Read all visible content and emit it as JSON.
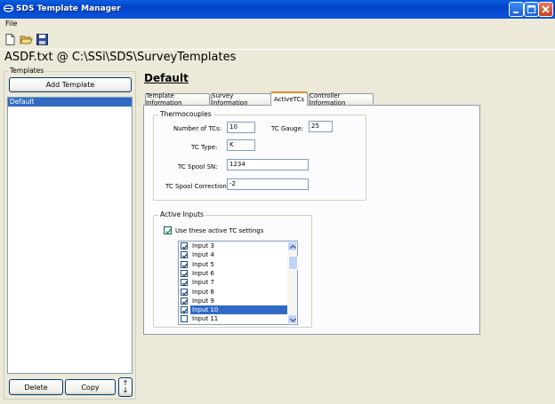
{
  "window": {
    "title": "SDS Template Manager"
  },
  "menu": {
    "file": "File"
  },
  "toolbar": {
    "icons": [
      "new-file-icon",
      "open-folder-icon",
      "save-icon"
    ]
  },
  "path_heading": "ASDF.txt @ C:\\SSi\\SDS\\SurveyTemplates",
  "templates": {
    "group_label": "Templates",
    "add_label": "Add Template",
    "items": [
      "Default"
    ],
    "selected": "Default",
    "delete_label": "Delete",
    "copy_label": "Copy",
    "move_up": "↑",
    "move_down": "↓"
  },
  "template_heading": "Default",
  "tabs": [
    {
      "label": "Template Information"
    },
    {
      "label": "Survey Information"
    },
    {
      "label": "ActiveTCs"
    },
    {
      "label": "Controller Information"
    }
  ],
  "active_tab": "ActiveTCs",
  "thermocouples": {
    "group_label": "Thermocouples",
    "num_tcs_label": "Number of TCs:",
    "num_tcs_value": "10",
    "tc_gauge_label": "TC Gauge:",
    "tc_gauge_value": "25",
    "tc_type_label": "TC Type:",
    "tc_type_value": "K",
    "spool_sn_label": "TC Spool SN:",
    "spool_sn_value": "1234",
    "spool_corr_label": "TC Spool Correction:",
    "spool_corr_value": "-2"
  },
  "active_inputs": {
    "group_label": "Active Inputs",
    "use_label": "Use these active TC settings",
    "use_checked": true,
    "inputs": [
      {
        "label": "Input 3",
        "checked": true
      },
      {
        "label": "Input 4",
        "checked": true
      },
      {
        "label": "Input 5",
        "checked": true
      },
      {
        "label": "Input 6",
        "checked": true
      },
      {
        "label": "Input 7",
        "checked": true
      },
      {
        "label": "Input 8",
        "checked": true
      },
      {
        "label": "Input 9",
        "checked": true
      },
      {
        "label": "Input 10",
        "checked": true
      },
      {
        "label": "Input 11",
        "checked": false
      }
    ],
    "selected_input": "Input 10"
  },
  "colors": {
    "selection": "#316ac5",
    "title_bar": "#0142c7",
    "face": "#ece9d8"
  }
}
